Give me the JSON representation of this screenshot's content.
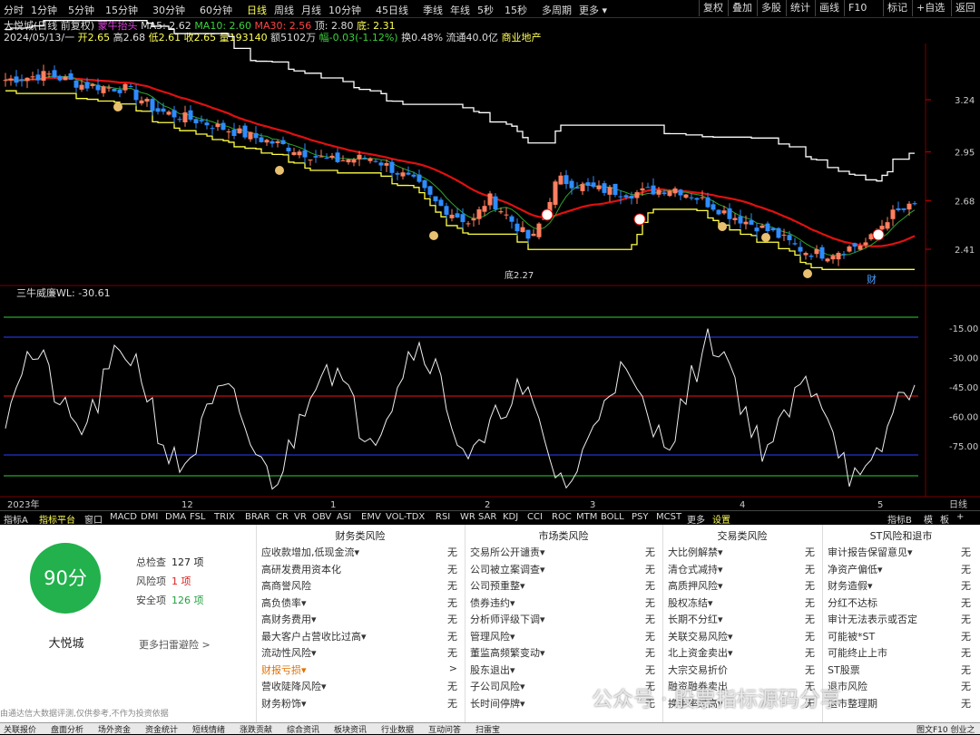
{
  "topbar": {
    "periods": [
      "分时",
      "1分钟",
      "5分钟",
      "15分钟",
      "30分钟",
      "60分钟",
      "日线",
      "周线",
      "月线",
      "10分钟",
      "45日线",
      "季线",
      "年线",
      "5秒",
      "15秒",
      "多周期",
      "更多 ▾"
    ],
    "active_period": "日线",
    "right_buttons": [
      "复权",
      "叠加",
      "多股",
      "统计",
      "画线",
      "F10",
      "标记",
      "+自选",
      "返回"
    ]
  },
  "quote": {
    "name": "大悦城(日线 前复权)",
    "indicator": "蒙牛抬头",
    "ma5_label": "MA5: 2.62",
    "ma10_label": "MA10: 2.60",
    "ma30_label": "MA30: 2.56",
    "top_label": "顶: 2.80",
    "bottom_label": "底: 2.31",
    "date": "2024/05/13/一",
    "open": "开2.65",
    "high": "高2.68",
    "low": "低2.61",
    "close": "收2.65",
    "volume": "量193140",
    "amount": "额5102万",
    "change": "幅-0.03(-1.12%)",
    "turnover": "换0.48%",
    "float_cap": "流通40.0亿",
    "industry": "商业地产"
  },
  "main_chart": {
    "y_ticks": [
      "3.24",
      "2.95",
      "2.68",
      "2.41"
    ],
    "annotations": {
      "bottom_low": "底2.27",
      "bottom_word": "底",
      "fin_word": "财"
    },
    "colors": {
      "up": "#ff7f5f",
      "down": "#2e8cff",
      "ma_red": "#e01010",
      "ma_green": "#2aa52a",
      "band": "#ffffff",
      "band_low": "#ffff44"
    }
  },
  "sub_chart": {
    "title": "三牛威廉",
    "wl_label": "WL: -30.61",
    "y_ticks": [
      "-15.00",
      "-30.00",
      "-45.00",
      "-60.00",
      "-75.00"
    ]
  },
  "x_axis": {
    "labels": [
      "2023年",
      "12",
      "1",
      "2",
      "3",
      "4",
      "5"
    ],
    "right": "日线"
  },
  "tabs": {
    "items": [
      "指标A",
      "指标平台",
      "窗口",
      "MACD",
      "DMI",
      "DMA",
      "FSL",
      "TRIX",
      "BRAR",
      "CR",
      "VR",
      "OBV",
      "ASI",
      "EMV",
      "VOL-TDX",
      "RSI",
      "WR",
      "SAR",
      "KDJ",
      "CCI",
      "ROC",
      "MTM",
      "BOLL",
      "PSY",
      "MCST",
      "更多",
      "设置"
    ],
    "right": [
      "指标B",
      "模",
      "板",
      "+"
    ]
  },
  "panel": {
    "score": "90分",
    "stock_name": "大悦城",
    "total_label": "总检查",
    "total_value": "127 项",
    "risk_label": "风险项",
    "risk_value": "1 项",
    "safe_label": "安全项",
    "safe_value": "126 项",
    "more_link": "更多扫雷避险 >",
    "columns": [
      {
        "title": "财务类风险",
        "rows": [
          {
            "k": "应收款增加,低现金流▾",
            "v": "无"
          },
          {
            "k": "高研发费用资本化",
            "v": "无"
          },
          {
            "k": "高商誉风险",
            "v": "无"
          },
          {
            "k": "高负债率▾",
            "v": "无"
          },
          {
            "k": "高财务费用▾",
            "v": "无"
          },
          {
            "k": "最大客户占营收比过高▾",
            "v": "无"
          },
          {
            "k": "流动性风险▾",
            "v": "无"
          },
          {
            "k": "财报亏损▾",
            "v": ">",
            "hl": true
          },
          {
            "k": "营收陡降风险▾",
            "v": "无"
          },
          {
            "k": "财务粉饰▾",
            "v": "无"
          }
        ]
      },
      {
        "title": "市场类风险",
        "rows": [
          {
            "k": "交易所公开谴责▾",
            "v": "无"
          },
          {
            "k": "公司被立案调查▾",
            "v": "无"
          },
          {
            "k": "公司预重整▾",
            "v": "无"
          },
          {
            "k": "债券违约▾",
            "v": "无"
          },
          {
            "k": "分析师评级下调▾",
            "v": "无"
          },
          {
            "k": "管理风险▾",
            "v": "无"
          },
          {
            "k": "董监高频繁变动▾",
            "v": "无"
          },
          {
            "k": "股东退出▾",
            "v": "无"
          },
          {
            "k": "子公司风险▾",
            "v": "无"
          },
          {
            "k": "长时间停牌▾",
            "v": "无"
          }
        ]
      },
      {
        "title": "交易类风险",
        "rows": [
          {
            "k": "大比例解禁▾",
            "v": "无"
          },
          {
            "k": "清仓式减持▾",
            "v": "无"
          },
          {
            "k": "高质押风险▾",
            "v": "无"
          },
          {
            "k": "股权冻结▾",
            "v": "无"
          },
          {
            "k": "长期不分红▾",
            "v": "无"
          },
          {
            "k": "关联交易风险▾",
            "v": "无"
          },
          {
            "k": "北上资金卖出▾",
            "v": "无"
          },
          {
            "k": "大宗交易折价",
            "v": "无"
          },
          {
            "k": "融资融券卖出",
            "v": "无"
          },
          {
            "k": "换手率过高▾",
            "v": "无"
          }
        ]
      },
      {
        "title": "ST风险和退市",
        "rows": [
          {
            "k": "审计报告保留意见▾",
            "v": "无"
          },
          {
            "k": "净资产偏低▾",
            "v": "无"
          },
          {
            "k": "财务造假▾",
            "v": "无"
          },
          {
            "k": "分红不达标",
            "v": "无"
          },
          {
            "k": "审计无法表示或否定",
            "v": "无"
          },
          {
            "k": "可能被*ST",
            "v": "无"
          },
          {
            "k": "可能终止上市",
            "v": "无"
          },
          {
            "k": "ST股票",
            "v": "无"
          },
          {
            "k": "退市风险",
            "v": "无"
          },
          {
            "k": "退市整理期",
            "v": "无"
          }
        ]
      }
    ]
  },
  "watermark": "公众号 · 股票指标源码分享",
  "disclaimer": "由通达信大数据评测,仅供参考,不作为投资依据",
  "bottombar": [
    "关联报价",
    "盘面分析",
    "场外资金",
    "资金统计",
    "短线情绪",
    "涨跌贡献",
    "综合资讯",
    "板块资讯",
    "行业数据",
    "互动问答",
    "扫雷宝"
  ],
  "bottom_right": "图文F10  创业之"
}
